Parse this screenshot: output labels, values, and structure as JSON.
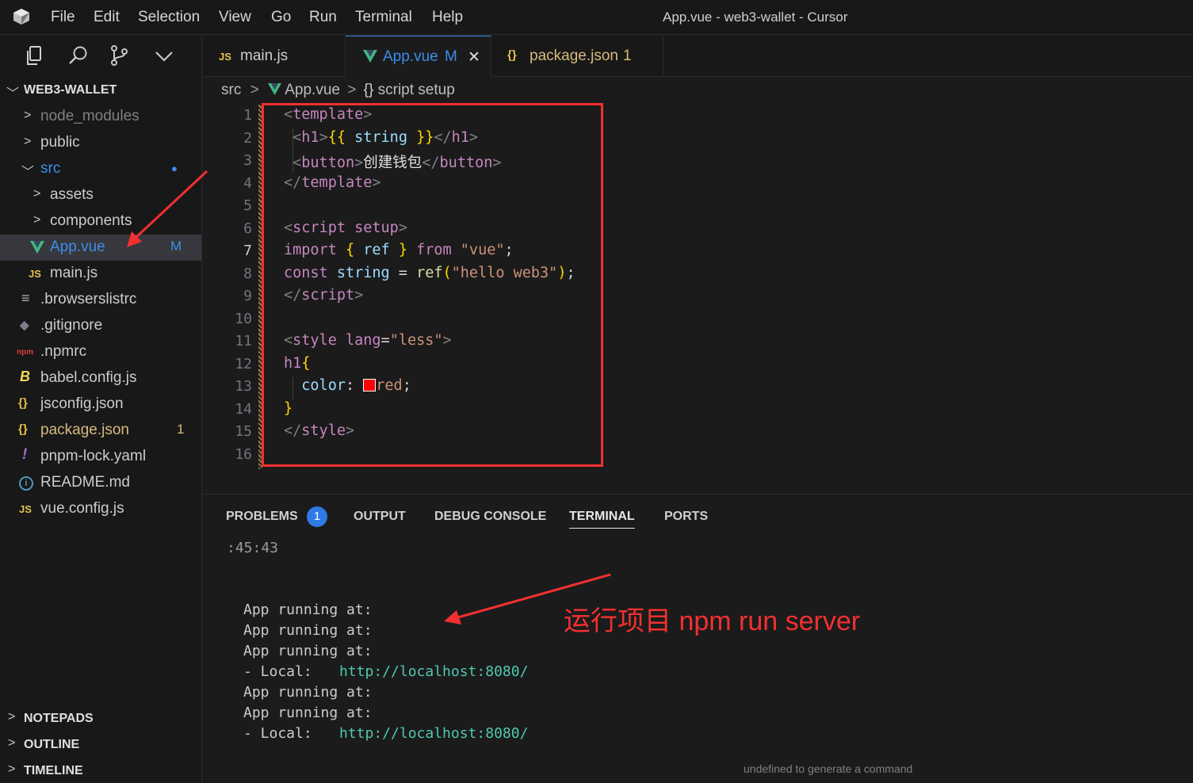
{
  "app": {
    "window_title": "App.vue - web3-wallet - Cursor",
    "menu": [
      "File",
      "Edit",
      "Selection",
      "View",
      "Go",
      "Run",
      "Terminal",
      "Help"
    ]
  },
  "explorer": {
    "root": "WEB3-WALLET",
    "items": [
      {
        "label": "node_modules",
        "type": "folder",
        "color": "#808080"
      },
      {
        "label": "public",
        "type": "folder",
        "color": "#cccccc"
      },
      {
        "label": "src",
        "type": "folder-open",
        "color": "#3b8eea",
        "badge": "●"
      },
      {
        "label": "assets",
        "type": "folder",
        "color": "#cccccc"
      },
      {
        "label": "components",
        "type": "folder",
        "color": "#cccccc"
      },
      {
        "label": "App.vue",
        "type": "vue",
        "color": "#3b8eea",
        "badge": "M"
      },
      {
        "label": "main.js",
        "type": "js",
        "color": "#cccccc"
      },
      {
        "label": ".browserslistrc",
        "type": "lines",
        "color": "#cccccc"
      },
      {
        "label": ".gitignore",
        "type": "git",
        "color": "#cccccc"
      },
      {
        "label": ".npmrc",
        "type": "npm",
        "color": "#cccccc"
      },
      {
        "label": "babel.config.js",
        "type": "babel",
        "color": "#cccccc"
      },
      {
        "label": "jsconfig.json",
        "type": "json",
        "color": "#cccccc"
      },
      {
        "label": "package.json",
        "type": "json",
        "color": "#d7ba7d",
        "badge": "1"
      },
      {
        "label": "pnpm-lock.yaml",
        "type": "yaml",
        "color": "#cccccc"
      },
      {
        "label": "README.md",
        "type": "info",
        "color": "#cccccc"
      },
      {
        "label": "vue.config.js",
        "type": "js",
        "color": "#cccccc"
      }
    ],
    "icons": {
      "js": "JS",
      "vue": "V",
      "json": "{}",
      "babel": "B",
      "yaml": "!",
      "info": "i",
      "npm": "npm",
      "git": "◆",
      "lines": "≡"
    },
    "sections": [
      "NOTEPADS",
      "OUTLINE",
      "TIMELINE"
    ]
  },
  "tabs": [
    {
      "label": "main.js",
      "icon": "JS",
      "suffix": ""
    },
    {
      "label": "App.vue",
      "icon": "V",
      "suffix": "M",
      "close": "✕"
    },
    {
      "label": "package.json",
      "icon": "{}",
      "suffix": "1"
    }
  ],
  "breadcrumb": {
    "folder": "src",
    "file": "App.vue",
    "symbol_icon": "{}",
    "symbol": "script setup"
  },
  "editor": {
    "line_numbers": [
      "1",
      "2",
      "3",
      "4",
      "5",
      "6",
      "7",
      "8",
      "9",
      "10",
      "11",
      "12",
      "13",
      "14",
      "15",
      "16"
    ],
    "color_swatch": "#ff0000"
  },
  "panel": {
    "tabs": [
      "PROBLEMS",
      "OUTPUT",
      "DEBUG CONSOLE",
      "TERMINAL",
      "PORTS"
    ],
    "problems_count": "1",
    "active_tab": "TERMINAL",
    "terminal": {
      "time_fragment": ":45:43",
      "running_label": "App running at:",
      "local_label": "- Local:",
      "local_url": "http://localhost:8080/",
      "footer_hint": "undefined to generate a command"
    }
  },
  "annotation": {
    "text": "运行项目 npm run server",
    "color": "#f23030"
  }
}
